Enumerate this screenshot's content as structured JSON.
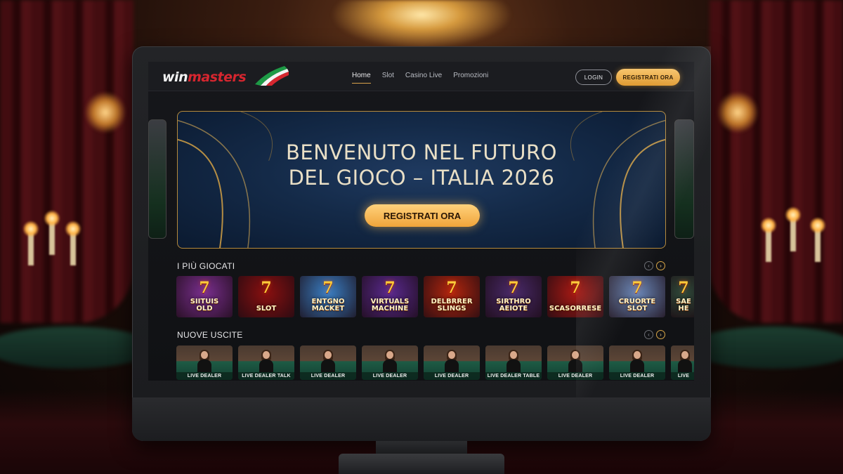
{
  "brand": {
    "logo_win": "win",
    "logo_masters": "masters"
  },
  "nav": {
    "links": [
      "Home",
      "Slot",
      "Casino Live",
      "Promozioni"
    ],
    "active_index": 0,
    "login": "LOGIN",
    "register": "REGISTRATI ORA"
  },
  "hero": {
    "title_line1": "BENVENUTO NEL FUTURO",
    "title_line2": "DEL GIOCO – ITALIA 2026",
    "cta": "REGISTRATI ORA"
  },
  "most_played": {
    "title": "I PIÙ GIOCATI",
    "games": [
      {
        "name": "SIITUIS\nOLD",
        "bg": "#7a2f8f"
      },
      {
        "name": "SLOT",
        "bg": "#8a1010"
      },
      {
        "name": "ENTGNO\nMACKET",
        "bg": "#3a7fc4"
      },
      {
        "name": "VIRTUALS\nMACHINE",
        "bg": "#5a2a8f"
      },
      {
        "name": "DELBRRER\nSLINGS",
        "bg": "#b3260e"
      },
      {
        "name": "SIRTHRO\nAEIOTE",
        "bg": "#4a2a6a"
      },
      {
        "name": "SCASORRESE",
        "bg": "#a81a14"
      },
      {
        "name": "CRUORTE\nSLOT",
        "bg": "#6a87b8"
      },
      {
        "name": "SAE\nHE",
        "bg": "#2f4a3a"
      }
    ]
  },
  "new_releases": {
    "title": "NUOVE USCITE",
    "tiles": [
      "LIVE DEALER",
      "LIVE DEALER TALK",
      "LIVE DEALER",
      "LIVE DEALER",
      "LIVE DEALER",
      "LIVE DEALER TABLE",
      "LIVE DEALER",
      "LIVE DEALER",
      "LIVE"
    ]
  },
  "colors": {
    "accent_gold": "#e8a83e",
    "brand_red": "#d6262f",
    "hero_bg": "#142a48"
  }
}
